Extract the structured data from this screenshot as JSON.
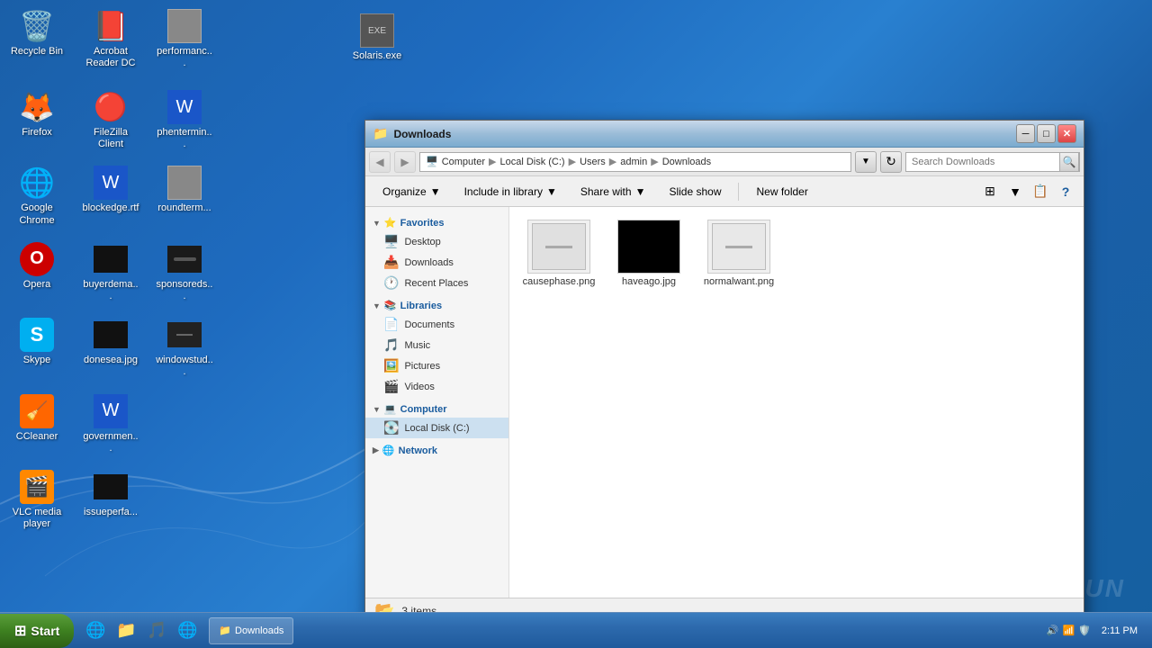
{
  "window": {
    "title": "Downloads",
    "titlebar_icon": "📁",
    "minimize": "─",
    "maximize": "□",
    "close": "✕"
  },
  "addressbar": {
    "back_disabled": true,
    "forward_disabled": true,
    "path": "Computer ▶ Local Disk (C:) ▶ Users ▶ admin ▶ Downloads",
    "path_segments": [
      "Computer",
      "Local Disk (C:)",
      "Users",
      "admin",
      "Downloads"
    ],
    "search_placeholder": "Search Downloads"
  },
  "toolbar": {
    "organize": "Organize",
    "include_in_library": "Include in library",
    "share_with": "Share with",
    "slide_show": "Slide show",
    "new_folder": "New folder",
    "chevron": "▼"
  },
  "sidebar": {
    "favorites_header": "Favorites",
    "favorites_items": [
      {
        "label": "Desktop",
        "icon": "🖥️"
      },
      {
        "label": "Downloads",
        "icon": "📥"
      },
      {
        "label": "Recent Places",
        "icon": "🕐"
      }
    ],
    "libraries_header": "Libraries",
    "libraries_items": [
      {
        "label": "Documents",
        "icon": "📄"
      },
      {
        "label": "Music",
        "icon": "🎵"
      },
      {
        "label": "Pictures",
        "icon": "🖼️"
      },
      {
        "label": "Videos",
        "icon": "🎬"
      }
    ],
    "computer_header": "Computer",
    "computer_items": [
      {
        "label": "Local Disk (C:)",
        "icon": "💽",
        "selected": true
      }
    ],
    "network_header": "Network",
    "network_items": []
  },
  "files": [
    {
      "name": "causephase.png",
      "preview": "light"
    },
    {
      "name": "haveago.jpg",
      "preview": "dark"
    },
    {
      "name": "normalwant.png",
      "preview": "light"
    }
  ],
  "statusbar": {
    "count": "3 items",
    "icon": "📂"
  },
  "desktop_icons": [
    {
      "label": "Recycle Bin",
      "icon": "🗑️",
      "row": 0
    },
    {
      "label": "Acrobat Reader DC",
      "icon": "📕",
      "row": 0
    },
    {
      "label": "performanc...",
      "icon": "⬜",
      "row": 0
    },
    {
      "label": "Solaris.exe",
      "icon": "⬛",
      "row": 0
    },
    {
      "label": "Firefox",
      "icon": "🦊",
      "row": 1
    },
    {
      "label": "FileZilla Client",
      "icon": "🔴",
      "row": 1
    },
    {
      "label": "phentermin...",
      "icon": "📘",
      "row": 1
    },
    {
      "label": "Google Chrome",
      "icon": "🌐",
      "row": 2
    },
    {
      "label": "blockedge.rtf",
      "icon": "📄",
      "row": 2
    },
    {
      "label": "roundterm...",
      "icon": "📃",
      "row": 2
    },
    {
      "label": "Opera",
      "icon": "🅾️",
      "row": 3
    },
    {
      "label": "buyerdema...",
      "icon": "📄",
      "row": 3
    },
    {
      "label": "sponsoreds...",
      "icon": "⬛",
      "row": 3
    },
    {
      "label": "Skype",
      "icon": "💬",
      "row": 4
    },
    {
      "label": "donesea.jpg",
      "icon": "⬛",
      "row": 4
    },
    {
      "label": "windowstud...",
      "icon": "⬜",
      "row": 4
    },
    {
      "label": "CCleaner",
      "icon": "🔧",
      "row": 5
    },
    {
      "label": "governmen...",
      "icon": "📄",
      "row": 5
    },
    {
      "label": "VLC media player",
      "icon": "🎬",
      "row": 6
    },
    {
      "label": "issueperfa...",
      "icon": "⬛",
      "row": 6
    }
  ],
  "taskbar": {
    "start_label": "Start",
    "time": "2:11 PM",
    "open_window_label": "Downloads",
    "taskbar_icons": [
      "🌐",
      "📁",
      "⊞",
      "🎵",
      "🌐",
      "🛡️"
    ]
  },
  "watermark": "ANY.RUN"
}
